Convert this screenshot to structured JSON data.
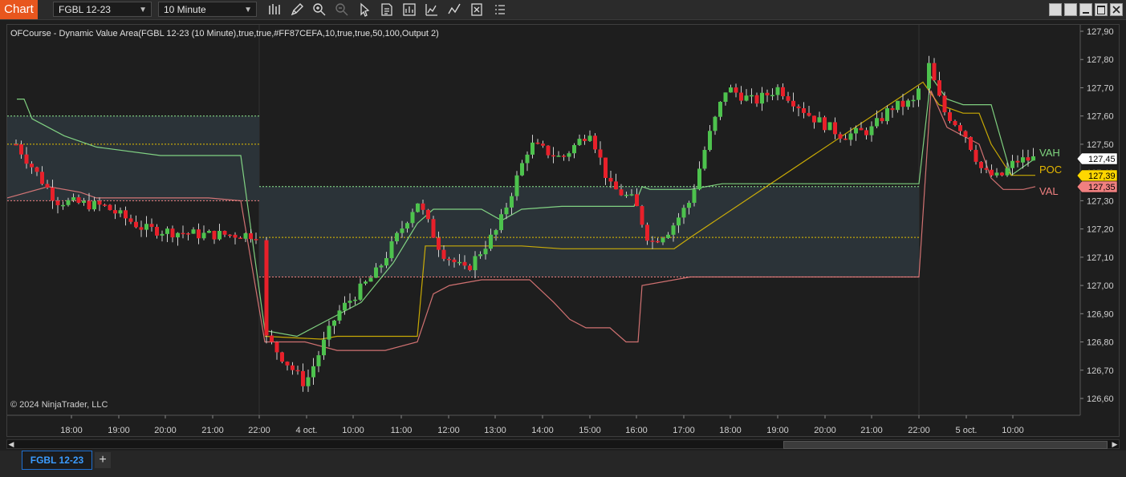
{
  "toolbar": {
    "app_label": "Chart",
    "instrument": "FGBL 12-23",
    "interval": "10 Minute",
    "tools": [
      "bar-type-icon",
      "pencil-icon",
      "zoom-in-icon",
      "zoom-out-icon",
      "pointer-icon",
      "data-box-icon",
      "bar-chart-icon",
      "strategy-icon",
      "properties-icon",
      "list-icon"
    ],
    "window_buttons": [
      "tile-icon",
      "restore-icon",
      "minimize-icon",
      "maximize-icon",
      "close-icon"
    ]
  },
  "chart": {
    "indicator_label": "OFCourse - Dynamic Value Area(FGBL 12-23 (10 Minute),true,true,#FF87CEFA,10,true,true,50,100,Output 2)",
    "copyright": "© 2024 NinjaTrader, LLC",
    "y_ticks": [
      "127,90",
      "127,80",
      "127,70",
      "127,60",
      "127,50",
      "127,40",
      "127,30",
      "127,20",
      "127,10",
      "127,00",
      "126,90",
      "126,80",
      "126,70",
      "126,60"
    ],
    "x_ticks": [
      "18:00",
      "19:00",
      "20:00",
      "21:00",
      "22:00",
      "4 oct.",
      "10:00",
      "11:00",
      "12:00",
      "13:00",
      "14:00",
      "15:00",
      "16:00",
      "17:00",
      "18:00",
      "19:00",
      "20:00",
      "21:00",
      "22:00",
      "5 oct.",
      "10:00"
    ],
    "price_badges": [
      {
        "text": "127,45",
        "bg": "#ffffff",
        "fg": "#000000"
      },
      {
        "text": "127,39",
        "bg": "#ffd700",
        "fg": "#000000"
      },
      {
        "text": "127,35",
        "bg": "#f08080",
        "fg": "#000000"
      }
    ],
    "line_labels": [
      {
        "text": "VAH",
        "color": "#7fd67f"
      },
      {
        "text": "POC",
        "color": "#e6b800"
      },
      {
        "text": "VAL",
        "color": "#f08080"
      }
    ],
    "colors": {
      "up": "#4dc24d",
      "down": "#e8202a",
      "vah": "#90ee90",
      "poc": "#e6c200",
      "val": "#f08080",
      "value_area": "#2b3338"
    }
  },
  "tabs": {
    "active": "FGBL 12-23",
    "add": "+"
  }
}
